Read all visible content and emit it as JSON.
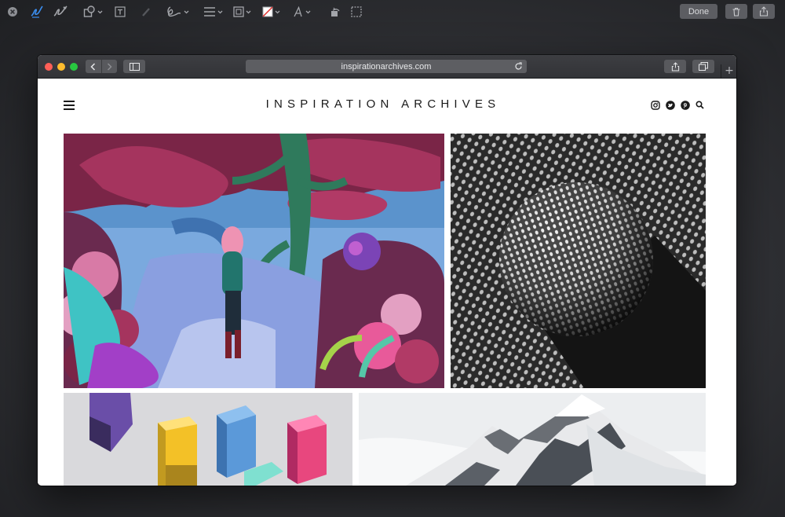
{
  "markup_toolbar": {
    "tools": [
      "close-icon",
      "sketch-icon",
      "draw-icon",
      "shapes-icon",
      "text-icon",
      "highlight-icon",
      "sign-icon",
      "shape-style-icon",
      "border-color-icon",
      "fill-color-icon",
      "text-style-icon",
      "rotate-icon",
      "crop-icon"
    ],
    "done_label": "Done",
    "right_buttons": [
      "trash-icon",
      "share-icon"
    ]
  },
  "browser": {
    "url": "inspirationarchives.com",
    "traffic_lights": {
      "close": "#ff5f57",
      "minimize": "#febc2e",
      "zoom": "#28c840"
    },
    "new_tab_label": "+"
  },
  "site": {
    "title": "INSPIRATION ARCHIVES",
    "social_icons": [
      "instagram-icon",
      "twitter-icon",
      "pinterest-icon",
      "search-icon"
    ]
  },
  "gallery": [
    {
      "name": "forest-illustration"
    },
    {
      "name": "dotted-sphere-photo"
    },
    {
      "name": "colored-cubes-photo"
    },
    {
      "name": "snowy-mountain-photo"
    }
  ]
}
